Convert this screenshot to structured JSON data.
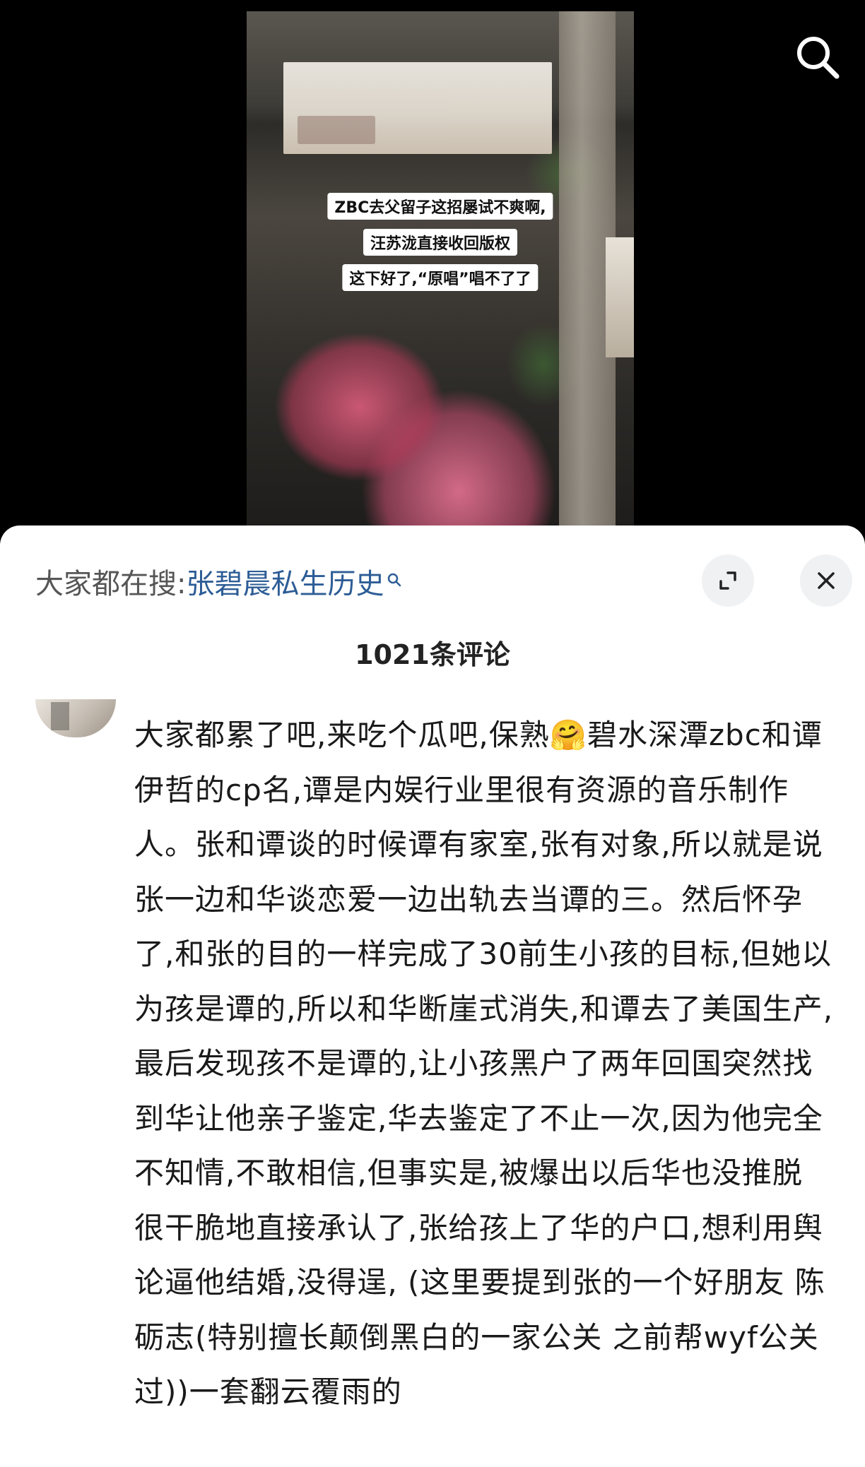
{
  "video": {
    "captions": [
      "ZBC去父留子这招屡试不爽啊,",
      "汪苏泷直接收回版权",
      "这下好了,“原唱”唱不了了"
    ]
  },
  "sheet": {
    "hot_search_label": "大家都在搜:",
    "hot_search_query": "张碧晨私生历史",
    "comment_count": "1021条评论"
  },
  "comment": {
    "parts": [
      "大家都累了吧,来吃个瓜吧,保熟",
      "碧水深潭zbc和谭伊哲的cp名,谭是内娱行业里很有资源的音乐制作人。张和谭谈的时候谭有家室,张有对象,所以就是说张一边和华谈恋爱一边出轨去当谭的三。然后怀孕了,和张的目的一样完成了30前生小孩的目标,但她以为孩是谭的,所以和华断崖式消失,和谭去了美国生产,最后发现孩不是谭的,让小孩黑户了两年回国突然找到华让他亲子鉴定,华去鉴定了不止一次,因为他完全不知情,不敢相信,但事实是,被爆出以后华也没推脱 很干脆地直接承认了,张给孩上了华的户口,想利用舆论逼他结婚,没得逞, (这里要提到张的一个好朋友 陈砺志(特别擅长颠倒黑白的一家公关 之前帮wyf公关过))一套翻云覆雨的"
    ],
    "emoji": "🤗"
  }
}
